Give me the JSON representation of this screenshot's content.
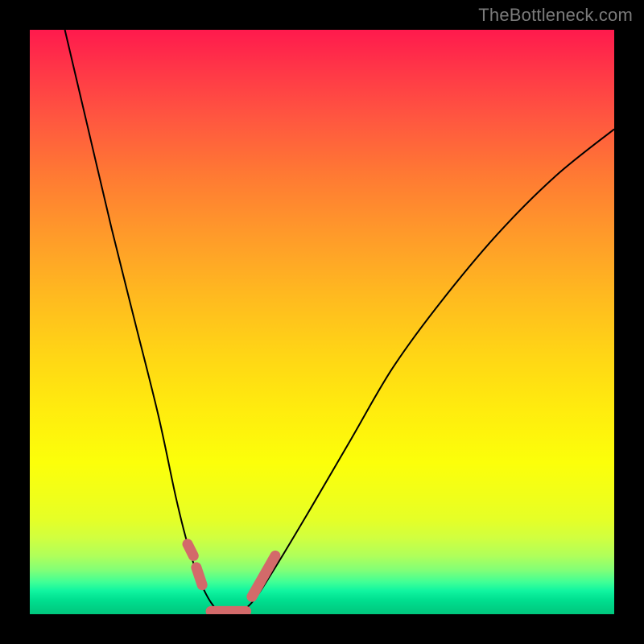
{
  "watermark": "TheBottleneck.com",
  "chart_data": {
    "type": "line",
    "title": "",
    "xlabel": "",
    "ylabel": "",
    "xlim": [
      0,
      100
    ],
    "ylim": [
      0,
      100
    ],
    "background_gradient": {
      "top": "#ff1a4d",
      "mid": "#ffec0e",
      "bottom": "#00c87e",
      "meaning": "red = high bottleneck, green = low bottleneck"
    },
    "series": [
      {
        "name": "bottleneck-curve",
        "x": [
          6,
          10,
          14,
          18,
          22,
          25,
          27,
          29,
          31,
          33,
          35,
          38,
          42,
          48,
          55,
          62,
          70,
          80,
          90,
          100
        ],
        "y": [
          100,
          83,
          66,
          50,
          34,
          20,
          12,
          6,
          2,
          0,
          0,
          2,
          8,
          18,
          30,
          42,
          53,
          65,
          75,
          83
        ]
      }
    ],
    "highlight_range": {
      "name": "optimal-zone-markers",
      "color": "#d36a6a",
      "segments": [
        {
          "x_start": 27,
          "x_end": 28,
          "y_start": 12,
          "y_end": 10
        },
        {
          "x_start": 28.5,
          "x_end": 29.5,
          "y_start": 8,
          "y_end": 5
        },
        {
          "x_start": 31,
          "x_end": 37,
          "y_start": 0.5,
          "y_end": 0.5
        },
        {
          "x_start": 38,
          "x_end": 42,
          "y_start": 3,
          "y_end": 10
        }
      ]
    }
  }
}
